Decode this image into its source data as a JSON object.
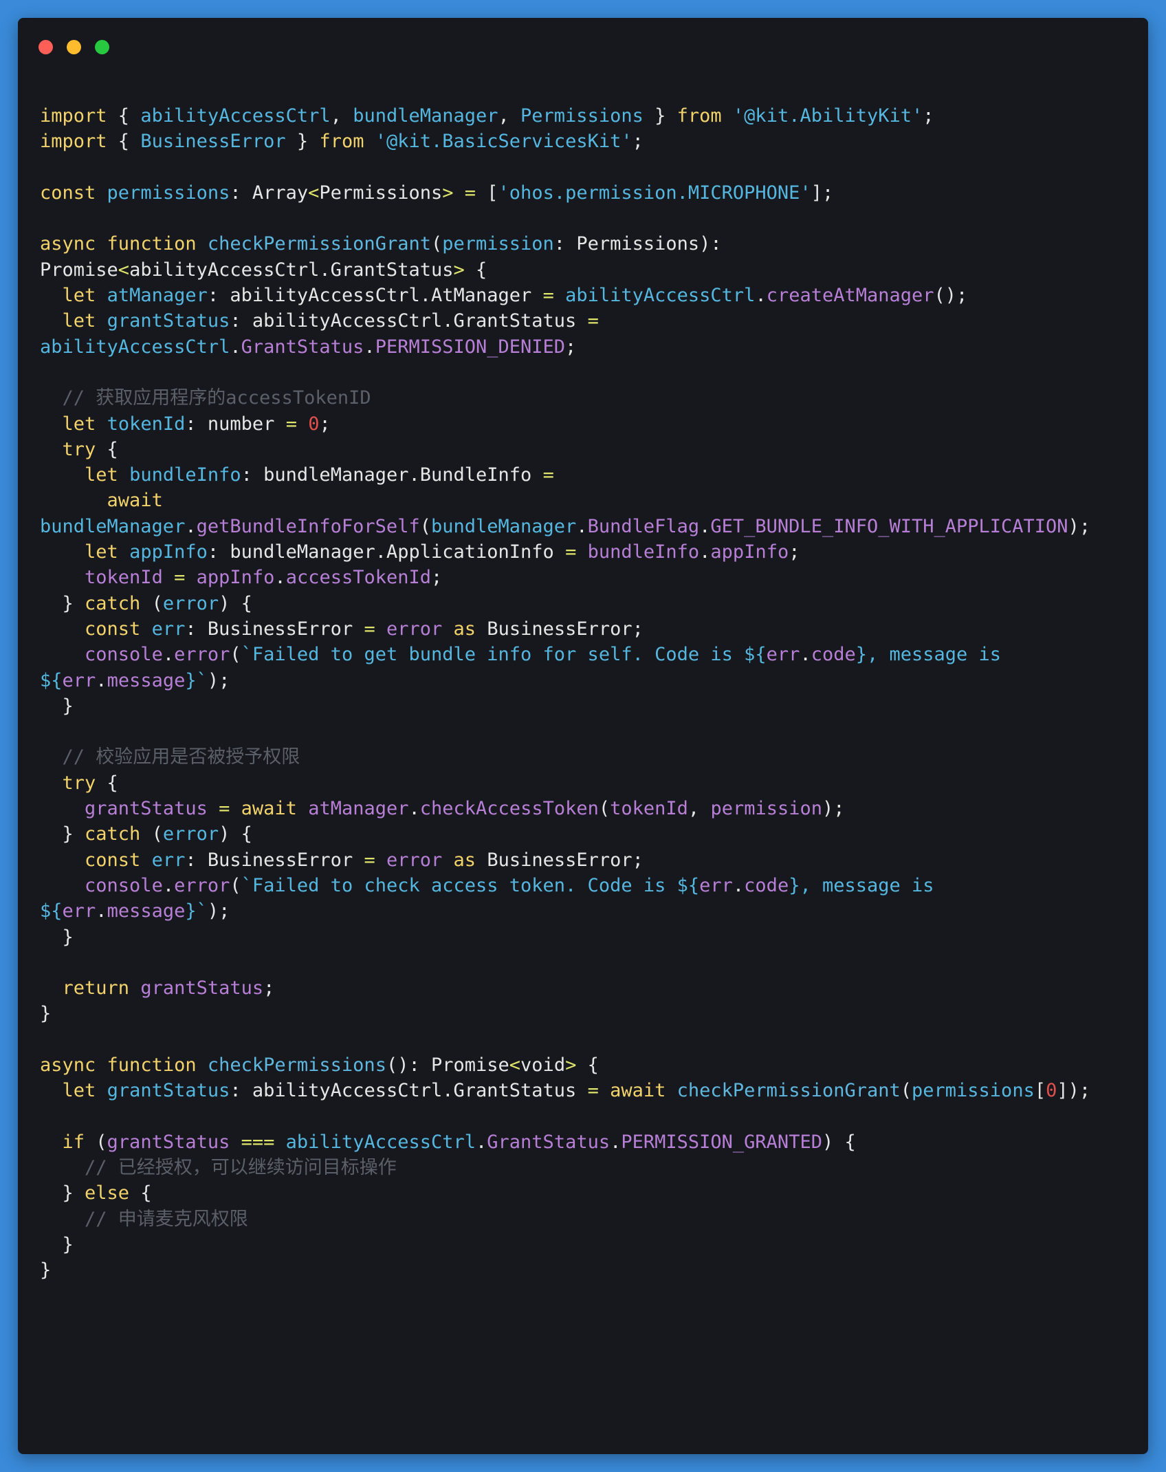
{
  "window": {
    "traffic_lights": [
      {
        "name": "close",
        "color": "#ff5f57"
      },
      {
        "name": "minimize",
        "color": "#febc2e"
      },
      {
        "name": "zoom",
        "color": "#28c840"
      }
    ]
  },
  "code": {
    "lines": [
      [
        [
          "kw",
          "import"
        ],
        [
          "pu",
          " { "
        ],
        [
          "id",
          "abilityAccessCtrl"
        ],
        [
          "pu",
          ", "
        ],
        [
          "id",
          "bundleManager"
        ],
        [
          "pu",
          ", "
        ],
        [
          "id",
          "Permissions"
        ],
        [
          "pu",
          " } "
        ],
        [
          "kw",
          "from"
        ],
        [
          "pu",
          " "
        ],
        [
          "str",
          "'@kit.AbilityKit'"
        ],
        [
          "pu",
          ";"
        ]
      ],
      [
        [
          "kw",
          "import"
        ],
        [
          "pu",
          " { "
        ],
        [
          "id",
          "BusinessError"
        ],
        [
          "pu",
          " } "
        ],
        [
          "kw",
          "from"
        ],
        [
          "pu",
          " "
        ],
        [
          "str",
          "'@kit.BasicServicesKit'"
        ],
        [
          "pu",
          ";"
        ]
      ],
      [],
      [
        [
          "kw",
          "const"
        ],
        [
          "pu",
          " "
        ],
        [
          "id",
          "permissions"
        ],
        [
          "pu",
          ": "
        ],
        [
          "ty",
          "Array"
        ],
        [
          "op",
          "<"
        ],
        [
          "ty",
          "Permissions"
        ],
        [
          "op",
          ">"
        ],
        [
          "pu",
          " "
        ],
        [
          "op",
          "="
        ],
        [
          "pu",
          " ["
        ],
        [
          "str",
          "'ohos.permission.MICROPHONE'"
        ],
        [
          "pu",
          "];"
        ]
      ],
      [],
      [
        [
          "kw",
          "async"
        ],
        [
          "pu",
          " "
        ],
        [
          "kw",
          "function"
        ],
        [
          "pu",
          " "
        ],
        [
          "fn",
          "checkPermissionGrant"
        ],
        [
          "pu",
          "("
        ],
        [
          "id",
          "permission"
        ],
        [
          "pu",
          ": "
        ],
        [
          "ty",
          "Permissions"
        ],
        [
          "pu",
          "):"
        ]
      ],
      [
        [
          "ty",
          "Promise"
        ],
        [
          "op",
          "<"
        ],
        [
          "ty",
          "abilityAccessCtrl.GrantStatus"
        ],
        [
          "op",
          ">"
        ],
        [
          "pu",
          " {"
        ]
      ],
      [
        [
          "pu",
          "  "
        ],
        [
          "kw",
          "let"
        ],
        [
          "pu",
          " "
        ],
        [
          "id",
          "atManager"
        ],
        [
          "pu",
          ": "
        ],
        [
          "ty",
          "abilityAccessCtrl.AtManager"
        ],
        [
          "pu",
          " "
        ],
        [
          "op",
          "="
        ],
        [
          "pu",
          " "
        ],
        [
          "id",
          "abilityAccessCtrl"
        ],
        [
          "pu",
          "."
        ],
        [
          "mem",
          "createAtManager"
        ],
        [
          "pu",
          "();"
        ]
      ],
      [
        [
          "pu",
          "  "
        ],
        [
          "kw",
          "let"
        ],
        [
          "pu",
          " "
        ],
        [
          "id",
          "grantStatus"
        ],
        [
          "pu",
          ": "
        ],
        [
          "ty",
          "abilityAccessCtrl.GrantStatus"
        ],
        [
          "pu",
          " "
        ],
        [
          "op",
          "="
        ]
      ],
      [
        [
          "id",
          "abilityAccessCtrl"
        ],
        [
          "pu",
          "."
        ],
        [
          "mem",
          "GrantStatus"
        ],
        [
          "pu",
          "."
        ],
        [
          "mem",
          "PERMISSION_DENIED"
        ],
        [
          "pu",
          ";"
        ]
      ],
      [],
      [
        [
          "pu",
          "  "
        ],
        [
          "cm",
          "// 获取应用程序的accessTokenID"
        ]
      ],
      [
        [
          "pu",
          "  "
        ],
        [
          "kw",
          "let"
        ],
        [
          "pu",
          " "
        ],
        [
          "id",
          "tokenId"
        ],
        [
          "pu",
          ": "
        ],
        [
          "ty",
          "number"
        ],
        [
          "pu",
          " "
        ],
        [
          "op",
          "="
        ],
        [
          "pu",
          " "
        ],
        [
          "num",
          "0"
        ],
        [
          "pu",
          ";"
        ]
      ],
      [
        [
          "pu",
          "  "
        ],
        [
          "kw",
          "try"
        ],
        [
          "pu",
          " {"
        ]
      ],
      [
        [
          "pu",
          "    "
        ],
        [
          "kw",
          "let"
        ],
        [
          "pu",
          " "
        ],
        [
          "id",
          "bundleInfo"
        ],
        [
          "pu",
          ": "
        ],
        [
          "ty",
          "bundleManager.BundleInfo"
        ],
        [
          "pu",
          " "
        ],
        [
          "op",
          "="
        ]
      ],
      [
        [
          "pu",
          "      "
        ],
        [
          "kw",
          "await"
        ]
      ],
      [
        [
          "id",
          "bundleManager"
        ],
        [
          "pu",
          "."
        ],
        [
          "mem",
          "getBundleInfoForSelf"
        ],
        [
          "pu",
          "("
        ],
        [
          "id",
          "bundleManager"
        ],
        [
          "pu",
          "."
        ],
        [
          "mem",
          "BundleFlag"
        ],
        [
          "pu",
          "."
        ],
        [
          "mem",
          "GET_BUNDLE_INFO_WITH_APPLICATION"
        ],
        [
          "pu",
          ");"
        ]
      ],
      [
        [
          "pu",
          "    "
        ],
        [
          "kw",
          "let"
        ],
        [
          "pu",
          " "
        ],
        [
          "id",
          "appInfo"
        ],
        [
          "pu",
          ": "
        ],
        [
          "ty",
          "bundleManager.ApplicationInfo"
        ],
        [
          "pu",
          " "
        ],
        [
          "op",
          "="
        ],
        [
          "pu",
          " "
        ],
        [
          "mem",
          "bundleInfo"
        ],
        [
          "pu",
          "."
        ],
        [
          "mem",
          "appInfo"
        ],
        [
          "pu",
          ";"
        ]
      ],
      [
        [
          "pu",
          "    "
        ],
        [
          "mem",
          "tokenId"
        ],
        [
          "pu",
          " "
        ],
        [
          "op",
          "="
        ],
        [
          "pu",
          " "
        ],
        [
          "mem",
          "appInfo"
        ],
        [
          "pu",
          "."
        ],
        [
          "mem",
          "accessTokenId"
        ],
        [
          "pu",
          ";"
        ]
      ],
      [
        [
          "pu",
          "  } "
        ],
        [
          "kw",
          "catch"
        ],
        [
          "pu",
          " ("
        ],
        [
          "id",
          "error"
        ],
        [
          "pu",
          ") {"
        ]
      ],
      [
        [
          "pu",
          "    "
        ],
        [
          "kw",
          "const"
        ],
        [
          "pu",
          " "
        ],
        [
          "id",
          "err"
        ],
        [
          "pu",
          ": "
        ],
        [
          "ty",
          "BusinessError"
        ],
        [
          "pu",
          " "
        ],
        [
          "op",
          "="
        ],
        [
          "pu",
          " "
        ],
        [
          "mem",
          "error"
        ],
        [
          "pu",
          " "
        ],
        [
          "kw",
          "as"
        ],
        [
          "pu",
          " "
        ],
        [
          "ty",
          "BusinessError"
        ],
        [
          "pu",
          ";"
        ]
      ],
      [
        [
          "pu",
          "    "
        ],
        [
          "mem",
          "console"
        ],
        [
          "pu",
          "."
        ],
        [
          "mem",
          "error"
        ],
        [
          "pu",
          "("
        ],
        [
          "str",
          "`Failed to get bundle info for self. Code is ${"
        ],
        [
          "mem",
          "err"
        ],
        [
          "pu",
          "."
        ],
        [
          "mem",
          "code"
        ],
        [
          "str",
          "}, message is"
        ]
      ],
      [
        [
          "str",
          "${"
        ],
        [
          "mem",
          "err"
        ],
        [
          "pu",
          "."
        ],
        [
          "mem",
          "message"
        ],
        [
          "str",
          "}`"
        ],
        [
          "pu",
          ");"
        ]
      ],
      [
        [
          "pu",
          "  }"
        ]
      ],
      [],
      [
        [
          "pu",
          "  "
        ],
        [
          "cm",
          "// 校验应用是否被授予权限"
        ]
      ],
      [
        [
          "pu",
          "  "
        ],
        [
          "kw",
          "try"
        ],
        [
          "pu",
          " {"
        ]
      ],
      [
        [
          "pu",
          "    "
        ],
        [
          "mem",
          "grantStatus"
        ],
        [
          "pu",
          " "
        ],
        [
          "op",
          "="
        ],
        [
          "pu",
          " "
        ],
        [
          "kw",
          "await"
        ],
        [
          "pu",
          " "
        ],
        [
          "mem",
          "atManager"
        ],
        [
          "pu",
          "."
        ],
        [
          "mem",
          "checkAccessToken"
        ],
        [
          "pu",
          "("
        ],
        [
          "mem",
          "tokenId"
        ],
        [
          "pu",
          ", "
        ],
        [
          "mem",
          "permission"
        ],
        [
          "pu",
          ");"
        ]
      ],
      [
        [
          "pu",
          "  } "
        ],
        [
          "kw",
          "catch"
        ],
        [
          "pu",
          " ("
        ],
        [
          "id",
          "error"
        ],
        [
          "pu",
          ") {"
        ]
      ],
      [
        [
          "pu",
          "    "
        ],
        [
          "kw",
          "const"
        ],
        [
          "pu",
          " "
        ],
        [
          "id",
          "err"
        ],
        [
          "pu",
          ": "
        ],
        [
          "ty",
          "BusinessError"
        ],
        [
          "pu",
          " "
        ],
        [
          "op",
          "="
        ],
        [
          "pu",
          " "
        ],
        [
          "mem",
          "error"
        ],
        [
          "pu",
          " "
        ],
        [
          "kw",
          "as"
        ],
        [
          "pu",
          " "
        ],
        [
          "ty",
          "BusinessError"
        ],
        [
          "pu",
          ";"
        ]
      ],
      [
        [
          "pu",
          "    "
        ],
        [
          "mem",
          "console"
        ],
        [
          "pu",
          "."
        ],
        [
          "mem",
          "error"
        ],
        [
          "pu",
          "("
        ],
        [
          "str",
          "`Failed to check access token. Code is ${"
        ],
        [
          "mem",
          "err"
        ],
        [
          "pu",
          "."
        ],
        [
          "mem",
          "code"
        ],
        [
          "str",
          "}, message is"
        ]
      ],
      [
        [
          "str",
          "${"
        ],
        [
          "mem",
          "err"
        ],
        [
          "pu",
          "."
        ],
        [
          "mem",
          "message"
        ],
        [
          "str",
          "}`"
        ],
        [
          "pu",
          ");"
        ]
      ],
      [
        [
          "pu",
          "  }"
        ]
      ],
      [],
      [
        [
          "pu",
          "  "
        ],
        [
          "kw",
          "return"
        ],
        [
          "pu",
          " "
        ],
        [
          "mem",
          "grantStatus"
        ],
        [
          "pu",
          ";"
        ]
      ],
      [
        [
          "pu",
          "}"
        ]
      ],
      [],
      [
        [
          "kw",
          "async"
        ],
        [
          "pu",
          " "
        ],
        [
          "kw",
          "function"
        ],
        [
          "pu",
          " "
        ],
        [
          "fn",
          "checkPermissions"
        ],
        [
          "pu",
          "(): "
        ],
        [
          "ty",
          "Promise"
        ],
        [
          "op",
          "<"
        ],
        [
          "ty",
          "void"
        ],
        [
          "op",
          ">"
        ],
        [
          "pu",
          " {"
        ]
      ],
      [
        [
          "pu",
          "  "
        ],
        [
          "kw",
          "let"
        ],
        [
          "pu",
          " "
        ],
        [
          "id",
          "grantStatus"
        ],
        [
          "pu",
          ": "
        ],
        [
          "ty",
          "abilityAccessCtrl.GrantStatus"
        ],
        [
          "pu",
          " "
        ],
        [
          "op",
          "="
        ],
        [
          "pu",
          " "
        ],
        [
          "kw",
          "await"
        ],
        [
          "pu",
          " "
        ],
        [
          "fn",
          "checkPermissionGrant"
        ],
        [
          "pu",
          "("
        ],
        [
          "id",
          "permissions"
        ],
        [
          "pu",
          "["
        ],
        [
          "num",
          "0"
        ],
        [
          "pu",
          "]);"
        ]
      ],
      [],
      [
        [
          "pu",
          "  "
        ],
        [
          "kw",
          "if"
        ],
        [
          "pu",
          " ("
        ],
        [
          "mem",
          "grantStatus"
        ],
        [
          "pu",
          " "
        ],
        [
          "op",
          "==="
        ],
        [
          "pu",
          " "
        ],
        [
          "id",
          "abilityAccessCtrl"
        ],
        [
          "pu",
          "."
        ],
        [
          "mem",
          "GrantStatus"
        ],
        [
          "pu",
          "."
        ],
        [
          "mem",
          "PERMISSION_GRANTED"
        ],
        [
          "pu",
          ") {"
        ]
      ],
      [
        [
          "pu",
          "    "
        ],
        [
          "cm",
          "// 已经授权，可以继续访问目标操作"
        ]
      ],
      [
        [
          "pu",
          "  } "
        ],
        [
          "kw",
          "else"
        ],
        [
          "pu",
          " {"
        ]
      ],
      [
        [
          "pu",
          "    "
        ],
        [
          "cm",
          "// 申请麦克风权限"
        ]
      ],
      [
        [
          "pu",
          "  }"
        ]
      ],
      [
        [
          "pu",
          "}"
        ]
      ]
    ]
  }
}
